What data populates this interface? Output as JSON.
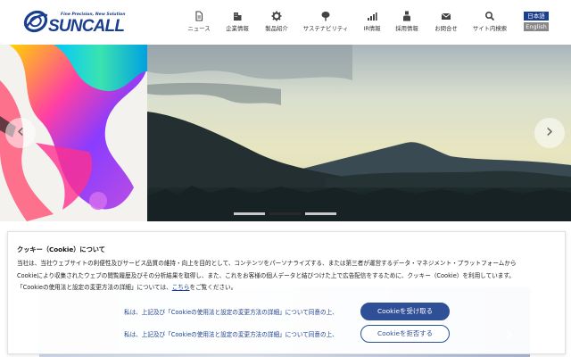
{
  "header": {
    "logo_tagline": "Fine Precision, New Solution",
    "logo_brand": "SUNCALL",
    "nav": [
      {
        "label": "ニュース",
        "icon": "document-icon"
      },
      {
        "label": "企業情報",
        "icon": "building-icon"
      },
      {
        "label": "製品紹介",
        "icon": "gear-icon"
      },
      {
        "label": "サステナビリティ",
        "icon": "tree-icon"
      },
      {
        "label": "IR情報",
        "icon": "bar-chart-icon"
      },
      {
        "label": "採用情報",
        "icon": "person-icon"
      },
      {
        "label": "お問合せ",
        "icon": "mail-icon"
      },
      {
        "label": "サイト内検索",
        "icon": "search-icon"
      }
    ],
    "lang_ja": "日本語",
    "lang_en": "English"
  },
  "hero": {
    "slide_count": 3,
    "active_slide": 2
  },
  "cookie": {
    "title": "クッキー（Cookie）について",
    "body_line1": "当社は、当社ウェブサイトの利便性及びサービス品質の維持・向上を目的として、コンテンツをパーソナライズする、または第三者が運営するデータ・マネジメント・プラットフォームから",
    "body_line2": "Cookieにより収集されたウェブの閲覧履歴及びその分析結果を取得し、また、これをお客様の個人データと結びつけた上で広告配信をするために、クッキー（Cookie）を利用しています。",
    "body_line3_pre": "「Cookieの使用法と設定の変更方法の詳細」については、",
    "body_line3_link": "こちら",
    "body_line3_post": "をご覧ください。",
    "consent_accept": "私は、上記及び「Cookieの使用法と設定の変更方法の詳細」について同意の上、",
    "accept_label": "Cookieを受け取る",
    "consent_reject": "私は、上記及び「Cookieの使用法と設定の変更方法の詳細」について同意の上、",
    "reject_label": "Cookieを拒否する"
  },
  "colors": {
    "brand": "#1b3f8f",
    "button": "#2f4f96"
  }
}
